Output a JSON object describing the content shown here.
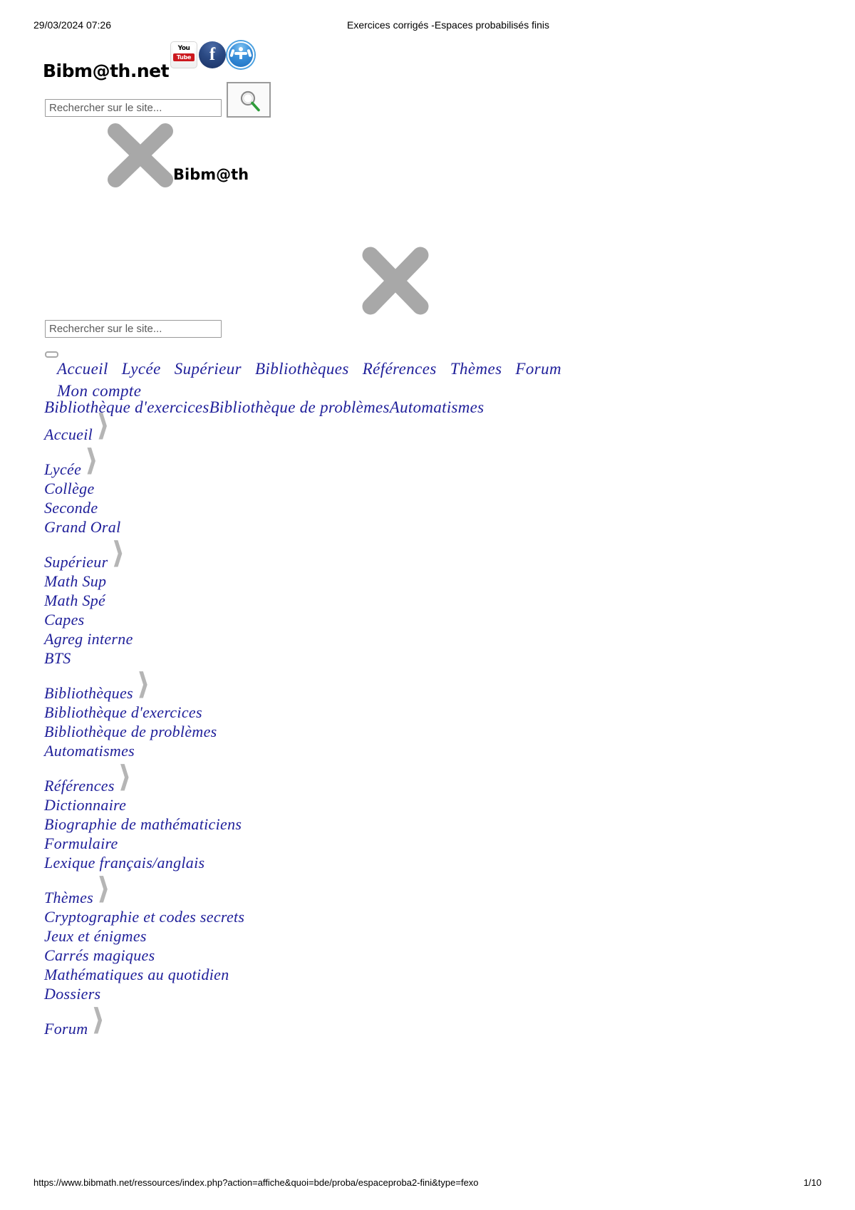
{
  "print": {
    "date": "29/03/2024 07:26",
    "doc_title": "Exercices corrigés -Espaces probabilisés finis",
    "url": "https://www.bibmath.net/ressources/index.php?action=affiche&quoi=bde/proba/espaceproba2-fini&type=fexo",
    "page": "1/10"
  },
  "brand": {
    "title": "Bibm@th.net",
    "broken_image_label": "Bibm@th",
    "social": [
      {
        "name": "youtube-icon",
        "line1": "You",
        "line2": "Tube"
      },
      {
        "name": "facebook-icon",
        "glyph": "f"
      },
      {
        "name": "accessibility-icon",
        "glyph": ""
      }
    ]
  },
  "search": {
    "placeholder": "Rechercher sur le site...",
    "value": "",
    "button_icon": "magnifier-icon"
  },
  "nav": {
    "items": [
      "Accueil",
      "Lycée",
      "Supérieur",
      "Bibliothèques",
      "Références",
      "Thèmes",
      "Forum",
      "Mon compte"
    ],
    "subnav": "Bibliothèque d'exercicesBibliothèque de problèmesAutomatismes"
  },
  "tree": {
    "groups": [
      {
        "head": "Accueil",
        "items": []
      },
      {
        "head": "Lycée",
        "items": [
          "Collège",
          "Seconde",
          "Grand Oral"
        ]
      },
      {
        "head": "Supérieur",
        "items": [
          "Math Sup",
          "Math Spé",
          "Capes",
          "Agreg interne",
          "BTS"
        ]
      },
      {
        "head": "Bibliothèques",
        "items": [
          "Bibliothèque d'exercices",
          "Bibliothèque de problèmes",
          "Automatismes"
        ]
      },
      {
        "head": "Références",
        "items": [
          "Dictionnaire",
          "Biographie de mathématiciens",
          "Formulaire",
          "Lexique français/anglais"
        ]
      },
      {
        "head": "Thèmes",
        "items": [
          "Cryptographie et codes secrets",
          "Jeux et énigmes",
          "Carrés magiques",
          "Mathématiques au quotidien",
          "Dossiers"
        ]
      },
      {
        "head": "Forum",
        "items": []
      }
    ]
  },
  "colors": {
    "nav_blue": "#20209a",
    "broken_gray": "#a8a8a8",
    "youtube_red": "#cc181e",
    "facebook_blue": "#2b4a84",
    "accessibility_blue": "#3d92dc"
  }
}
